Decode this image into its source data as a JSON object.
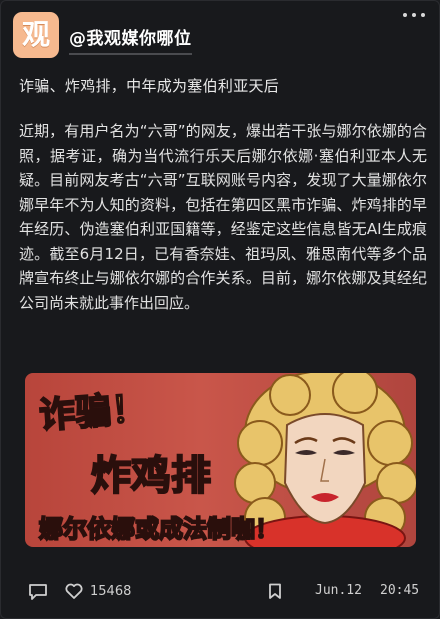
{
  "post": {
    "avatar_text": "观",
    "author_handle": "@我观媒你哪位",
    "headline": "诈骗、炸鸡排，中年成为塞伯利亚天后",
    "body": "近期，有用户名为“六哥”的网友，爆出若干张与娜尔依娜的合照，据考证，确为当代流行乐天后娜尔依娜·塞伯利亚本人无疑。目前网友考古“六哥”互联网账号内容，发现了大量娜依尔娜早年不为人知的资料，包括在第四区黑市诈骗、炸鸡排的早年经历、伪造塞伯利亚国籍等，经鉴定这些信息皆无AI生成痕迹。截至6月12日，已有香奈娃、祖玛凤、雅思南代等多个品牌宣布终止与娜依尔娜的合作关系。目前，娜尔依娜及其经纪公司尚未就此事作出回应。",
    "image": {
      "caption_1": "诈骗！",
      "caption_2": "炸鸡排",
      "caption_3": "娜尔依娜或成法制咖！"
    }
  },
  "footer": {
    "like_count": "15468",
    "date": "Jun.12",
    "time": "20:45"
  },
  "colors": {
    "background": "#18191c",
    "avatar_bg": "#f6b98f",
    "image_bg": "#c9564a",
    "caption_yellow": "#f7d338"
  },
  "icons": [
    "more-icon",
    "comment-icon",
    "heart-icon",
    "bookmark-icon"
  ]
}
